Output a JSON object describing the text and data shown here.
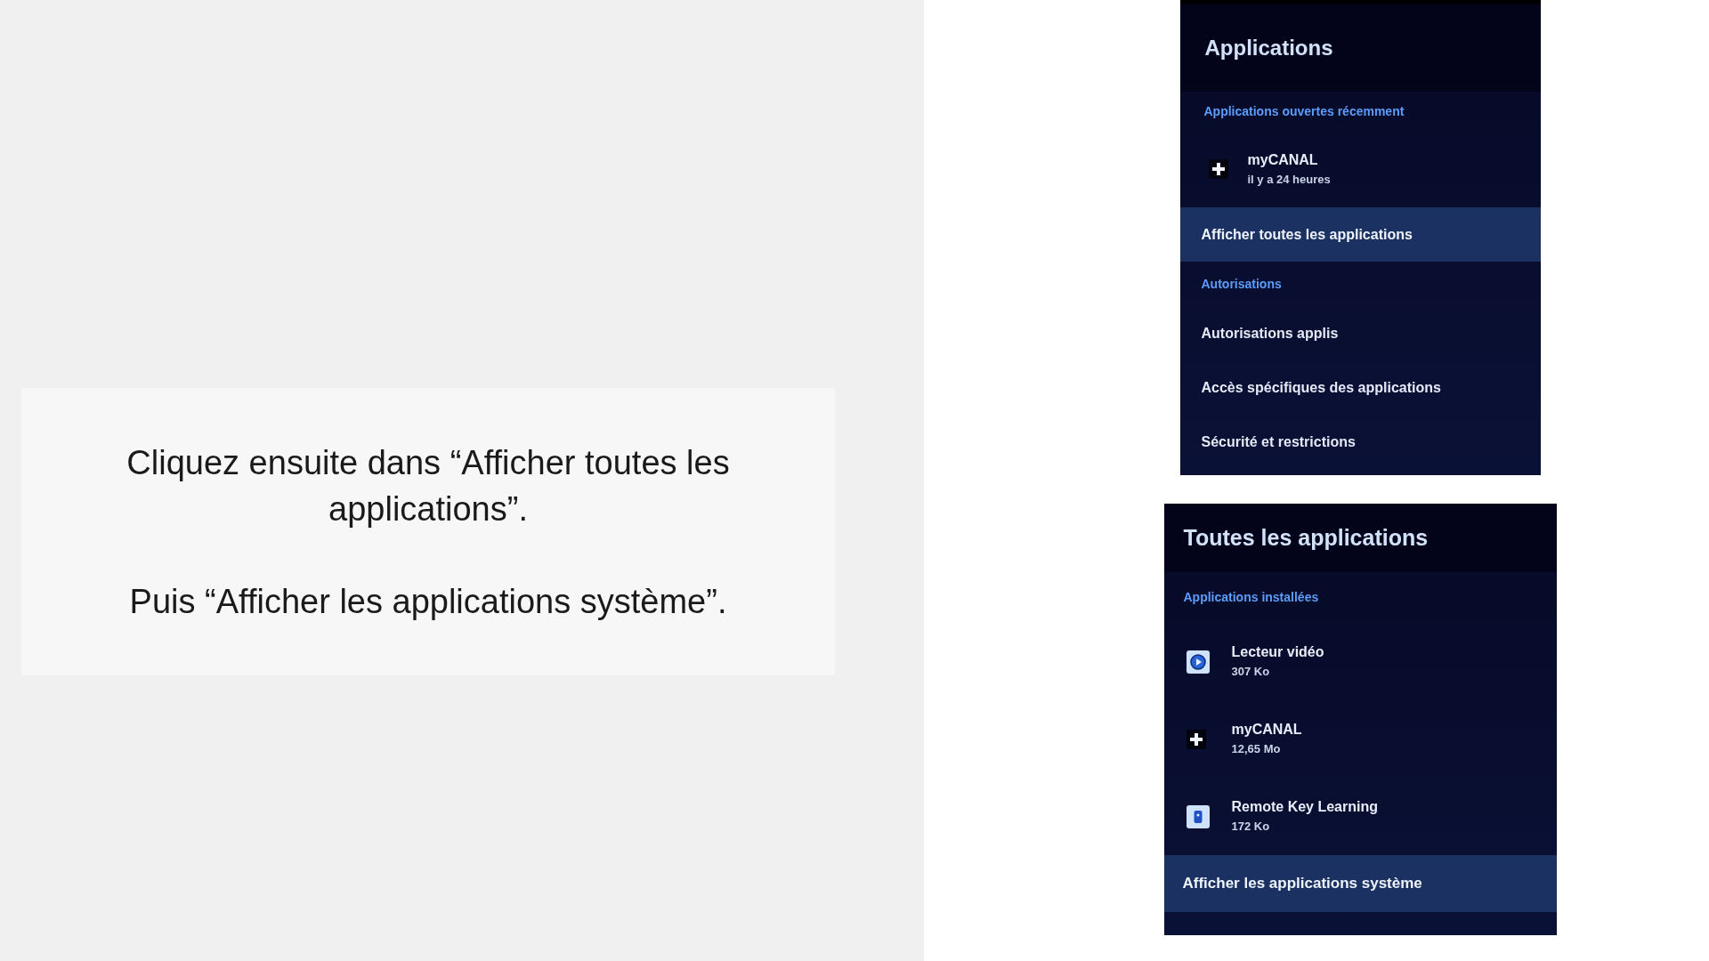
{
  "instructions": {
    "paragraphs": [
      "Cliquez ensuite dans “Afficher toutes les applications”.",
      "Puis “Afficher les applications système”."
    ]
  },
  "screens": [
    {
      "title": "Applications",
      "items": [
        {
          "kind": "section",
          "label": "Applications ouvertes récemment"
        },
        {
          "kind": "app",
          "name": "myCANAL",
          "detail": "il y a 24 heures",
          "selected": false
        },
        {
          "kind": "action",
          "label": "Afficher toutes les applications",
          "selected": true
        },
        {
          "kind": "section",
          "label": "Autorisations"
        },
        {
          "kind": "action",
          "label": "Autorisations applis",
          "selected": false
        },
        {
          "kind": "action",
          "label": "Accès spécifiques des applications",
          "selected": false
        },
        {
          "kind": "action",
          "label": "Sécurité et restrictions",
          "selected": false
        }
      ]
    },
    {
      "title": "Toutes les applications",
      "items": [
        {
          "kind": "section",
          "label": "Applications installées"
        },
        {
          "kind": "app",
          "name": "Lecteur vidéo",
          "detail": "307 Ko",
          "selected": false
        },
        {
          "kind": "app",
          "name": "myCANAL",
          "detail": "12,65 Mo",
          "selected": false
        },
        {
          "kind": "app",
          "name": "Remote Key Learning",
          "detail": "172 Ko",
          "selected": false
        },
        {
          "kind": "action",
          "label": "Afficher les applications système",
          "selected": true
        }
      ]
    }
  ]
}
